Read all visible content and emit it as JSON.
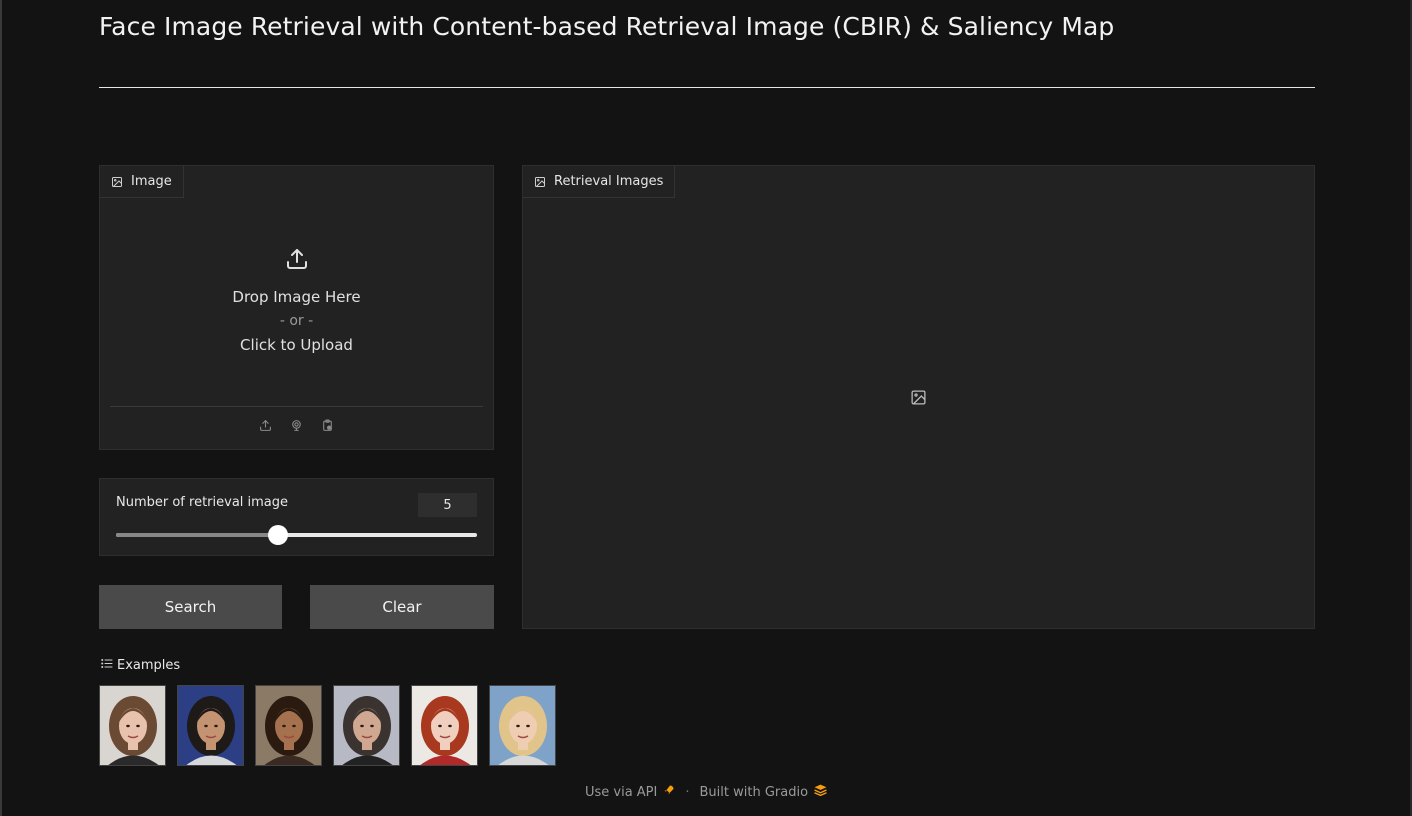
{
  "page": {
    "title": "Face Image Retrieval with Content-based Retrieval Image (CBIR) & Saliency Map"
  },
  "image_input": {
    "label": "Image",
    "drop_text": "Drop Image Here",
    "or_text": "- or -",
    "click_text": "Click to Upload",
    "sources": [
      "upload-icon",
      "webcam-icon",
      "clipboard-icon"
    ]
  },
  "slider": {
    "label": "Number of retrieval image",
    "value": "5",
    "fraction": 0.45
  },
  "buttons": {
    "search": "Search",
    "clear": "Clear"
  },
  "gallery": {
    "label": "Retrieval Images"
  },
  "examples": {
    "label": "Examples",
    "items": [
      {
        "icon": "face-thumbnail-icon",
        "hair": "#6b4a34",
        "bg": "#d9d6d2",
        "skin": "#e8c2ad",
        "shirt": "#2a2a2a"
      },
      {
        "icon": "face-thumbnail-icon",
        "hair": "#1e1a18",
        "bg": "#2c3f85",
        "skin": "#c49372",
        "shirt": "#d6d8dc"
      },
      {
        "icon": "face-thumbnail-icon",
        "hair": "#2a1a10",
        "bg": "#8a7a66",
        "skin": "#a5714f",
        "shirt": "#3a2a22"
      },
      {
        "icon": "face-thumbnail-icon",
        "hair": "#3a3330",
        "bg": "#b7b9c4",
        "skin": "#d0a790",
        "shirt": "#222"
      },
      {
        "icon": "face-thumbnail-icon",
        "hair": "#a8381e",
        "bg": "#ece8e4",
        "skin": "#f0cfbf",
        "shirt": "#b02a2a"
      },
      {
        "icon": "face-thumbnail-icon",
        "hair": "#e0c48a",
        "bg": "#7fa3c8",
        "skin": "#efcdb2",
        "shirt": "#d8d8d8"
      }
    ]
  },
  "footer": {
    "api_text": "Use via API",
    "built_text": "Built with Gradio",
    "separator": "·"
  },
  "colors": {
    "background": "#131313",
    "panel": "#222222",
    "button": "#4a4a4a",
    "accent": "#f59e0b"
  }
}
